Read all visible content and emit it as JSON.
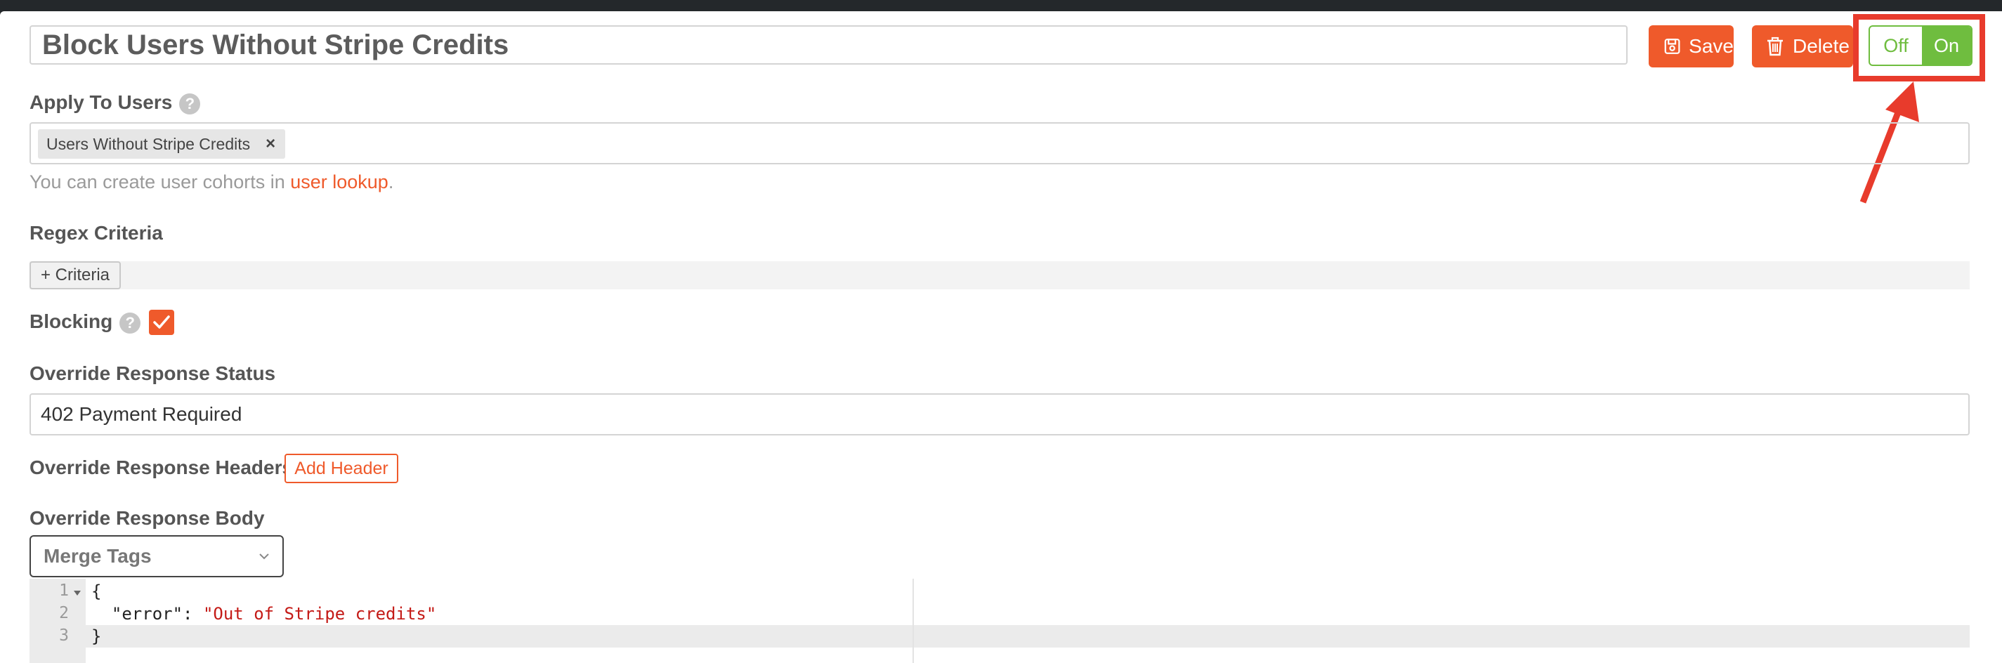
{
  "rule": {
    "title": "Block Users Without Stripe Credits",
    "save_label": "Save",
    "delete_label": "Delete",
    "toggle": {
      "off_label": "Off",
      "on_label": "On",
      "state": "on"
    }
  },
  "apply_to_users": {
    "label": "Apply To Users",
    "help": "?",
    "chips": [
      {
        "label": "Users Without Stripe Credits",
        "remove": "×"
      }
    ],
    "hint_prefix": "You can create user cohorts in ",
    "hint_link": "user lookup",
    "hint_suffix": "."
  },
  "regex_criteria": {
    "label": "Regex Criteria",
    "add_label": "+ Criteria"
  },
  "blocking": {
    "label": "Blocking",
    "help": "?",
    "checked": true
  },
  "override_status": {
    "label": "Override Response Status",
    "value": "402 Payment Required"
  },
  "override_headers": {
    "label": "Override Response Headers",
    "add_label": "Add Header"
  },
  "override_body": {
    "label": "Override Response Body",
    "merge_tags_label": "Merge Tags",
    "lines": [
      {
        "no": "1",
        "text": "{"
      },
      {
        "no": "2",
        "key": "  \"error\": ",
        "value": "\"Out of Stripe credits\""
      },
      {
        "no": "3",
        "text": "}"
      }
    ]
  },
  "colors": {
    "accent": "#ef5a2b",
    "toggle_on": "#6fbd3f",
    "highlight": "#e83b2c"
  }
}
